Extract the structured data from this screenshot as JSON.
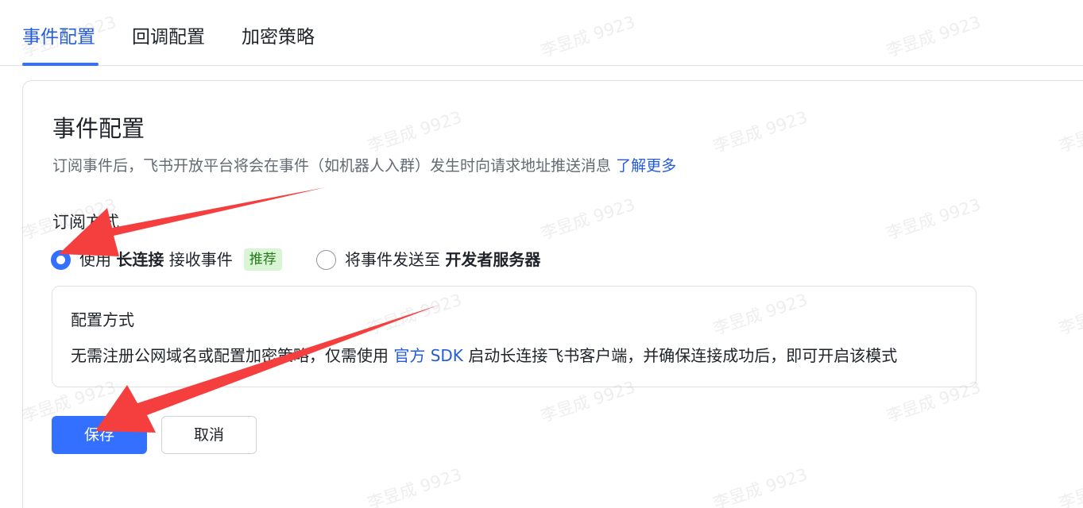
{
  "tabs": [
    {
      "label": "事件配置",
      "active": true
    },
    {
      "label": "回调配置",
      "active": false
    },
    {
      "label": "加密策略",
      "active": false
    }
  ],
  "card": {
    "title": "事件配置",
    "description": "订阅事件后，飞书开放平台将会在事件（如机器人入群）发生时向请求地址推送消息",
    "learn_more": "了解更多"
  },
  "subscription": {
    "label": "订阅方式",
    "option1": {
      "prefix": "使用",
      "bold": "长连接",
      "suffix": "接收事件",
      "badge": "推荐",
      "checked": true
    },
    "option2": {
      "prefix": "将事件发送至",
      "bold": "开发者服务器",
      "checked": false
    }
  },
  "config_box": {
    "title": "配置方式",
    "text_before": "无需注册公网域名或配置加密策略，仅需使用 ",
    "sdk_link": "官方 SDK",
    "text_after": " 启动长连接飞书客户端，并确保连接成功后，即可开启该模式"
  },
  "buttons": {
    "save": "保存",
    "cancel": "取消"
  },
  "watermark": "李昱成 9923",
  "colors": {
    "accent": "#3370ff",
    "link": "#245bdb",
    "badge_bg": "#d9f5d6",
    "badge_text": "#237b19",
    "annotation_arrow": "#f53f3f"
  }
}
